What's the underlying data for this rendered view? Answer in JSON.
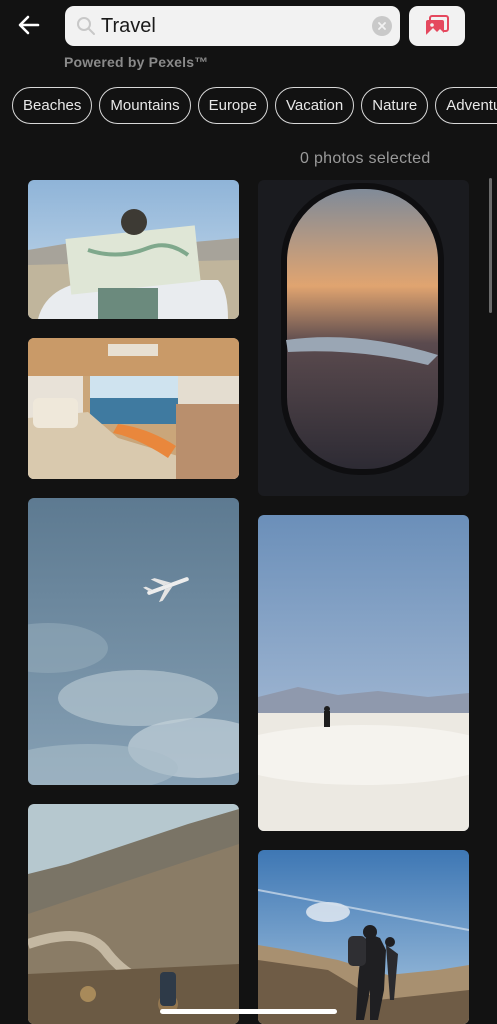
{
  "search": {
    "value": "Travel"
  },
  "powered_by": "Powered by Pexels™",
  "chips": [
    "Beaches",
    "Mountains",
    "Europe",
    "Vacation",
    "Nature",
    "Adventure"
  ],
  "selection": {
    "count_text": "0 photos selected"
  },
  "photos": [
    {
      "subject": "woman reading map on car hood"
    },
    {
      "subject": "van interior facing ocean"
    },
    {
      "subject": "airplane in cloudy sky"
    },
    {
      "subject": "mountain trail with hiker"
    },
    {
      "subject": "sunset through airplane window"
    },
    {
      "subject": "person walking on white sand dunes"
    },
    {
      "subject": "hikers on cliff under sky"
    }
  ],
  "colors": {
    "background": "#121212",
    "accent": "#e5485e"
  }
}
